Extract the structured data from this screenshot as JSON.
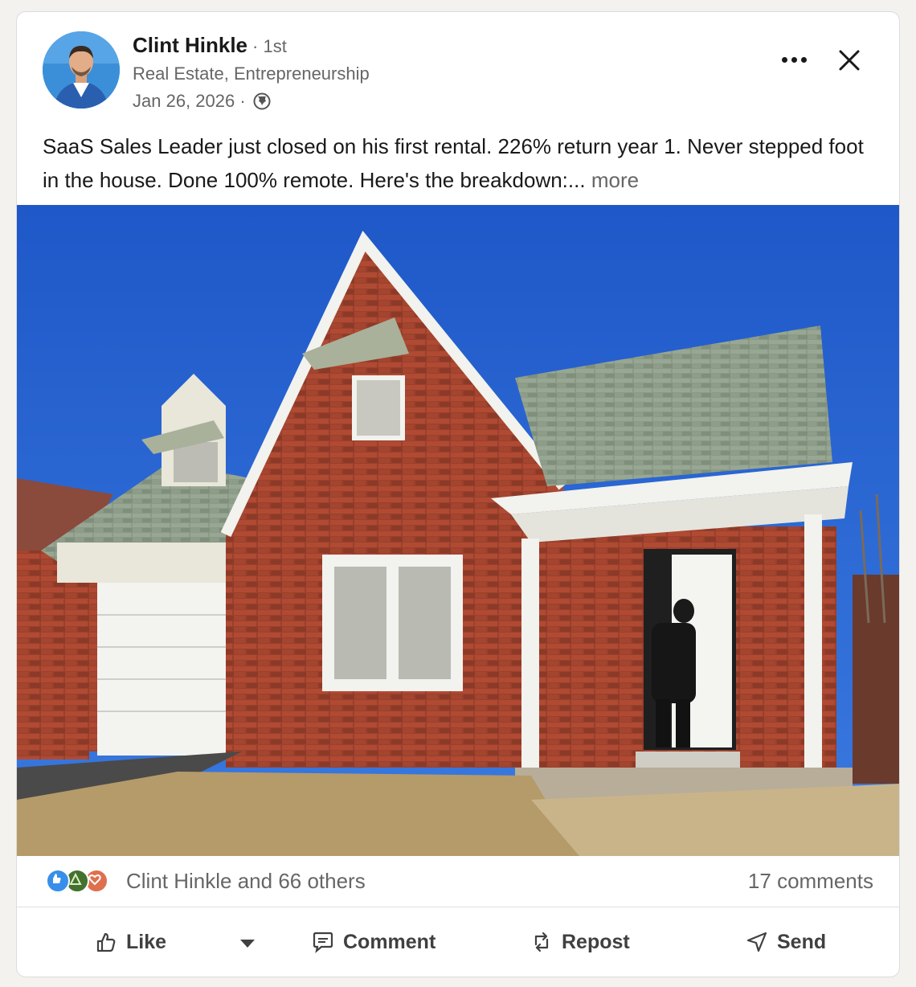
{
  "post": {
    "author": {
      "name": "Clint Hinkle",
      "degree": "· 1st",
      "headline": "Real Estate, Entrepreneurship",
      "date": "Jan 26, 2026 ·"
    },
    "icons": {
      "menu": "more-horizontal-icon",
      "close": "close-icon",
      "visibility": "globe-icon"
    },
    "text": "SaaS Sales Leader just closed on his first rental. 226% return year 1. Never stepped foot in the house. Done 100% remote. Here's the breakdown:...",
    "more_label": "more",
    "photo_description": "brick house with garage and porch",
    "social": {
      "reactions_label": "Clint Hinkle and 66 others",
      "comments_label": "17 comments",
      "reaction_types": [
        "like",
        "celebrate",
        "love"
      ]
    },
    "actions": {
      "like": "Like",
      "comment": "Comment",
      "repost": "Repost",
      "send": "Send"
    },
    "colors": {
      "like": "#378fe9",
      "celebrate": "#44712e",
      "love": "#df704d",
      "sky": "#1f5fd0"
    }
  }
}
